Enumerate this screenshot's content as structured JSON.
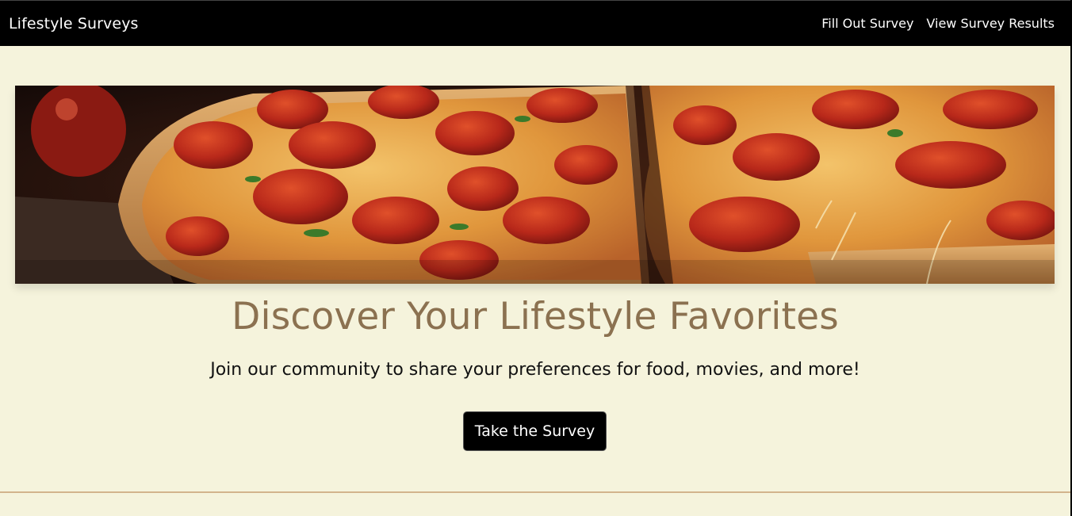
{
  "navbar": {
    "brand": "Lifestyle Surveys",
    "links": [
      {
        "label": "Fill Out Survey"
      },
      {
        "label": "View Survey Results"
      }
    ]
  },
  "hero": {
    "image_alt": "Pepperoni pizza",
    "title": "Discover Your Lifestyle Favorites",
    "subtitle": "Join our community to share your preferences for food, movies, and more!",
    "cta_label": "Take the Survey"
  },
  "colors": {
    "page_background": "#f5f3dc",
    "navbar_background": "#000000",
    "title_color": "#8b7150",
    "divider_color": "#d2b48c"
  }
}
